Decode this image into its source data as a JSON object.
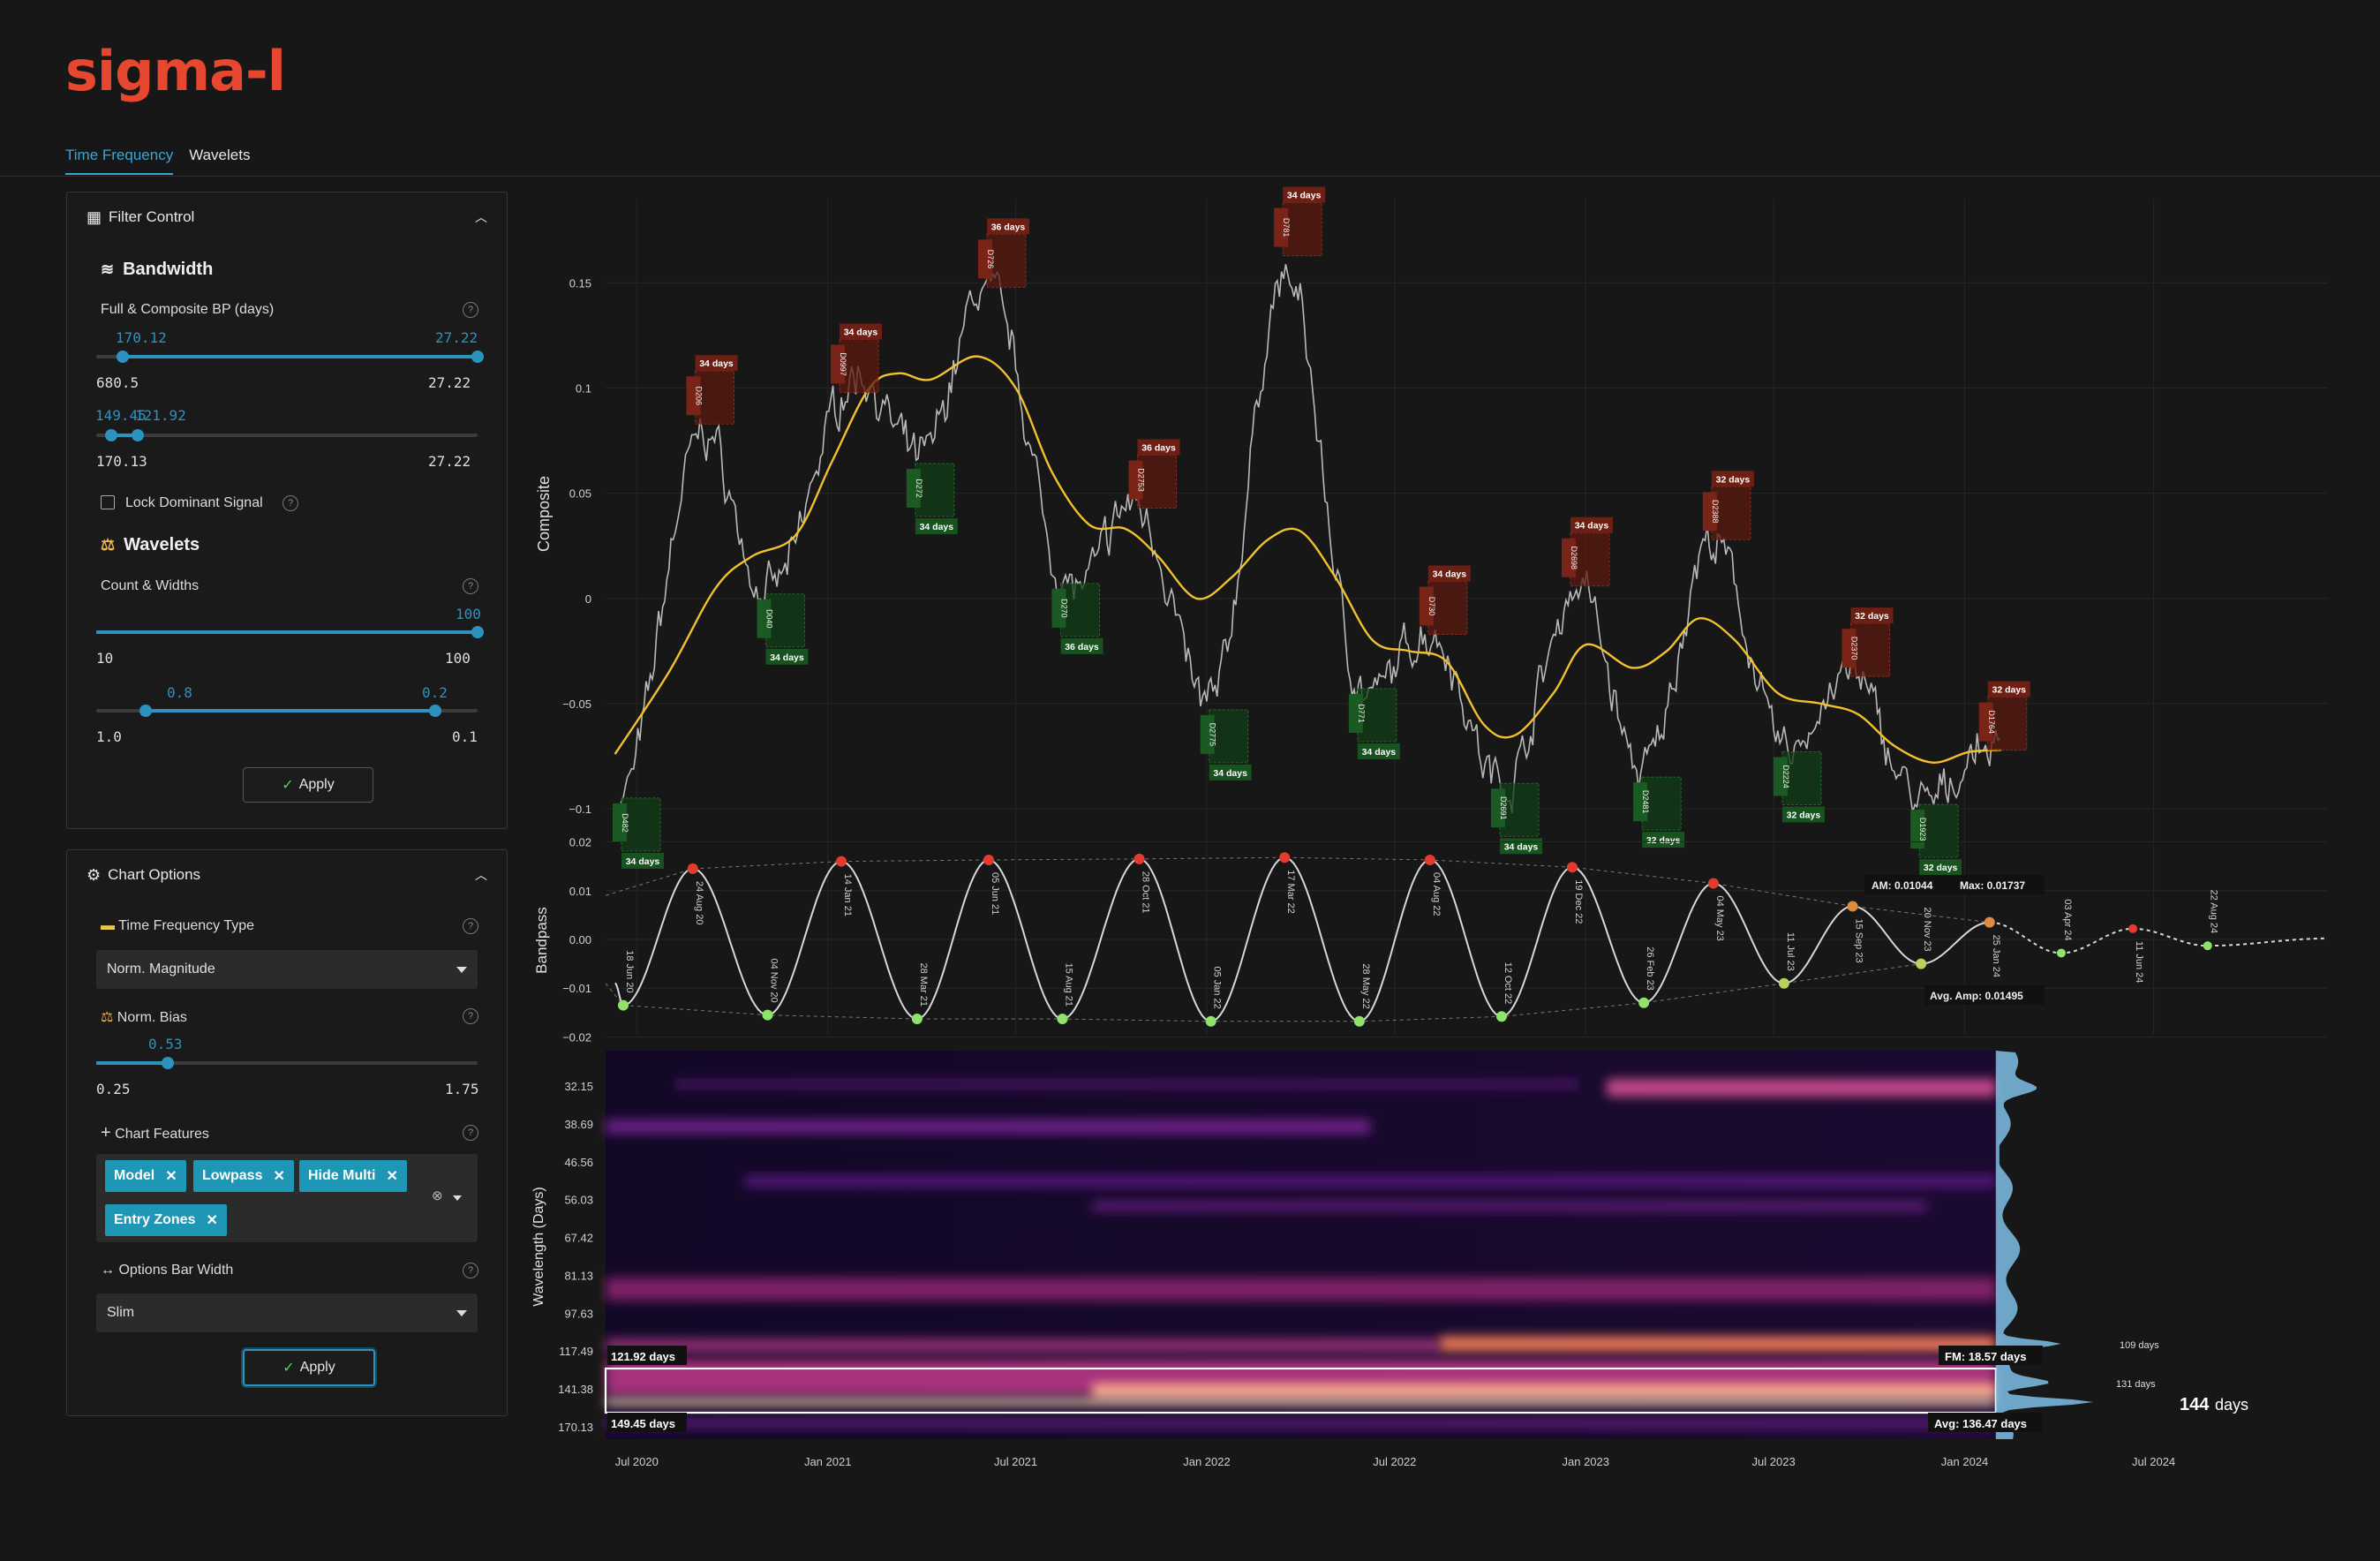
{
  "app": {
    "logo": "sigma-l"
  },
  "tabs": [
    {
      "label": "Time Frequency",
      "active": true
    },
    {
      "label": "Wavelets",
      "active": false
    }
  ],
  "filter_control": {
    "title": "Filter Control",
    "bandwidth": {
      "heading": "Bandwidth",
      "label": "Full & Composite BP (days)",
      "slider1": {
        "low_value": "170.12",
        "high_value": "27.22",
        "min_label": "680.5",
        "max_label": "27.22",
        "low_frac": 0.07,
        "high_frac": 1.0
      },
      "slider2": {
        "low_value": "149.45",
        "high_value": "121.92",
        "min_label": "170.13",
        "max_label": "27.22",
        "low_frac": 0.04,
        "high_frac": 0.108
      }
    },
    "lock_label": "Lock Dominant Signal",
    "wavelets": {
      "heading": "Wavelets",
      "label": "Count & Widths",
      "slider1": {
        "value": "100",
        "min_label": "10",
        "max_label": "100",
        "frac": 1.0
      },
      "slider2": {
        "low_value": "0.8",
        "high_value": "0.2",
        "min_label": "1.0",
        "max_label": "0.1",
        "low_frac": 0.22,
        "high_frac": 0.89
      }
    },
    "apply_label": "Apply"
  },
  "chart_options": {
    "title": "Chart Options",
    "tf_type": {
      "label": "Time Frequency Type",
      "value": "Norm. Magnitude"
    },
    "norm_bias": {
      "label": "Norm. Bias",
      "value": "0.53",
      "min_label": "0.25",
      "max_label": "1.75",
      "frac": 0.187
    },
    "features": {
      "label": "Chart Features",
      "tags": [
        "Model",
        "Lowpass",
        "Hide Multi",
        "Entry Zones"
      ]
    },
    "bar_width": {
      "label": "Options Bar Width",
      "value": "Slim"
    },
    "apply_label": "Apply"
  },
  "chart_data": [
    {
      "type": "line",
      "ylabel": "Composite",
      "ylim": [
        -0.105,
        0.19
      ],
      "yticks": [
        {
          "v": 0.15,
          "t": "0.15"
        },
        {
          "v": 0.1,
          "t": "0.1"
        },
        {
          "v": 0.05,
          "t": "0.05"
        },
        {
          "v": 0,
          "t": "0"
        },
        {
          "v": -0.05,
          "t": "−0.05"
        },
        {
          "v": -0.1,
          "t": "−0.1"
        }
      ],
      "xlim": [
        "2020-06-01",
        "2024-12-15"
      ],
      "lowpass": [
        [
          "2020-06-10",
          -0.074
        ],
        [
          "2020-08-01",
          -0.035
        ],
        [
          "2020-09-15",
          0.005
        ],
        [
          "2020-10-20",
          0.02
        ],
        [
          "2020-12-01",
          0.03
        ],
        [
          "2021-01-05",
          0.065
        ],
        [
          "2021-02-10",
          0.1
        ],
        [
          "2021-03-10",
          0.107
        ],
        [
          "2021-04-10",
          0.104
        ],
        [
          "2021-05-25",
          0.115
        ],
        [
          "2021-07-01",
          0.1
        ],
        [
          "2021-08-05",
          0.06
        ],
        [
          "2021-09-10",
          0.035
        ],
        [
          "2021-10-15",
          0.033
        ],
        [
          "2021-11-15",
          0.02
        ],
        [
          "2021-12-22",
          0.0
        ],
        [
          "2022-01-25",
          0.01
        ],
        [
          "2022-03-01",
          0.028
        ],
        [
          "2022-04-01",
          0.032
        ],
        [
          "2022-05-05",
          0.01
        ],
        [
          "2022-06-10",
          -0.02
        ],
        [
          "2022-07-15",
          -0.025
        ],
        [
          "2022-08-20",
          -0.03
        ],
        [
          "2022-09-25",
          -0.06
        ],
        [
          "2022-10-25",
          -0.065
        ],
        [
          "2022-12-01",
          -0.045
        ],
        [
          "2023-01-01",
          -0.022
        ],
        [
          "2023-02-15",
          -0.033
        ],
        [
          "2023-03-20",
          -0.025
        ],
        [
          "2023-04-20",
          -0.0095
        ],
        [
          "2023-05-25",
          -0.02
        ],
        [
          "2023-07-05",
          -0.045
        ],
        [
          "2023-08-15",
          -0.05
        ],
        [
          "2023-09-20",
          -0.055
        ],
        [
          "2023-10-25",
          -0.07
        ],
        [
          "2023-12-01",
          -0.078
        ],
        [
          "2024-01-05",
          -0.073
        ],
        [
          "2024-02-05",
          -0.072
        ]
      ],
      "markers": [
        {
          "date": "2020-06-18",
          "kind": "trough",
          "code": "D482",
          "label": "34 days",
          "v": -0.097
        },
        {
          "date": "2020-08-28",
          "kind": "peak",
          "code": "D206",
          "label": "34 days",
          "v": 0.085
        },
        {
          "date": "2020-11-04",
          "kind": "trough",
          "code": "D040",
          "label": "34 days",
          "v": -0.0
        },
        {
          "date": "2021-01-14",
          "kind": "peak",
          "code": "D0997",
          "label": "34 days",
          "v": 0.1
        },
        {
          "date": "2021-03-28",
          "kind": "trough",
          "code": "D272",
          "label": "34 days",
          "v": 0.062
        },
        {
          "date": "2021-06-05",
          "kind": "peak",
          "code": "D726",
          "label": "36 days",
          "v": 0.15
        },
        {
          "date": "2021-08-15",
          "kind": "trough",
          "code": "D270",
          "label": "36 days",
          "v": 0.005
        },
        {
          "date": "2021-10-28",
          "kind": "peak",
          "code": "D2753",
          "label": "36 days",
          "v": 0.045
        },
        {
          "date": "2022-01-05",
          "kind": "trough",
          "code": "D2775",
          "label": "34 days",
          "v": -0.055
        },
        {
          "date": "2022-03-17",
          "kind": "peak",
          "code": "D781",
          "label": "34 days",
          "v": 0.165
        },
        {
          "date": "2022-05-28",
          "kind": "trough",
          "code": "D771",
          "label": "34 days",
          "v": -0.045
        },
        {
          "date": "2022-08-04",
          "kind": "peak",
          "code": "D730",
          "label": "34 days",
          "v": -0.015
        },
        {
          "date": "2022-10-12",
          "kind": "trough",
          "code": "D2691",
          "label": "34 days",
          "v": -0.09
        },
        {
          "date": "2022-12-19",
          "kind": "peak",
          "code": "D2698",
          "label": "34 days",
          "v": 0.008
        },
        {
          "date": "2023-02-26",
          "kind": "trough",
          "code": "D2481",
          "label": "32 days",
          "v": -0.087
        },
        {
          "date": "2023-05-04",
          "kind": "peak",
          "code": "D2388",
          "label": "32 days",
          "v": 0.03
        },
        {
          "date": "2023-07-11",
          "kind": "trough",
          "code": "D2224",
          "label": "32 days",
          "v": -0.075
        },
        {
          "date": "2023-09-15",
          "kind": "peak",
          "code": "D2370",
          "label": "32 days",
          "v": -0.035
        },
        {
          "date": "2023-11-20",
          "kind": "trough",
          "code": "D1923",
          "label": "32 days",
          "v": -0.1
        },
        {
          "date": "2024-01-25",
          "kind": "peak",
          "code": "D1764",
          "label": "32 days",
          "v": -0.07
        }
      ]
    },
    {
      "type": "line",
      "ylabel": "Bandpass",
      "ylim": [
        -0.021,
        0.021
      ],
      "yticks": [
        {
          "v": 0.02,
          "t": "0.02"
        },
        {
          "v": 0.01,
          "t": "0.01"
        },
        {
          "v": 0,
          "t": "0.00"
        },
        {
          "v": -0.01,
          "t": "−0.01"
        },
        {
          "v": -0.02,
          "t": "−0.02"
        }
      ],
      "extrema": [
        {
          "date": "2020-06-18",
          "label": "18 Jun 20",
          "kind": "trough",
          "v": -0.0135
        },
        {
          "date": "2020-08-24",
          "label": "24 Aug 20",
          "kind": "peak",
          "v": 0.0145
        },
        {
          "date": "2020-11-04",
          "label": "04 Nov 20",
          "kind": "trough",
          "v": -0.0155
        },
        {
          "date": "2021-01-14",
          "label": "14 Jan 21",
          "kind": "peak",
          "v": 0.016
        },
        {
          "date": "2021-03-28",
          "label": "28 Mar 21",
          "kind": "trough",
          "v": -0.0163
        },
        {
          "date": "2021-06-05",
          "label": "05 Jun 21",
          "kind": "peak",
          "v": 0.0163
        },
        {
          "date": "2021-08-15",
          "label": "15 Aug 21",
          "kind": "trough",
          "v": -0.0163
        },
        {
          "date": "2021-10-28",
          "label": "28 Oct 21",
          "kind": "peak",
          "v": 0.0165
        },
        {
          "date": "2022-01-05",
          "label": "05 Jan 22",
          "kind": "trough",
          "v": -0.0168
        },
        {
          "date": "2022-03-17",
          "label": "17 Mar 22",
          "kind": "peak",
          "v": 0.0168
        },
        {
          "date": "2022-05-28",
          "label": "28 May 22",
          "kind": "trough",
          "v": -0.0168
        },
        {
          "date": "2022-08-04",
          "label": "04 Aug 22",
          "kind": "peak",
          "v": 0.0163
        },
        {
          "date": "2022-10-12",
          "label": "12 Oct 22",
          "kind": "trough",
          "v": -0.0158
        },
        {
          "date": "2022-12-19",
          "label": "19 Dec 22",
          "kind": "peak",
          "v": 0.0148
        },
        {
          "date": "2023-02-26",
          "label": "26 Feb 23",
          "kind": "trough",
          "v": -0.013
        },
        {
          "date": "2023-05-04",
          "label": "04 May 23",
          "kind": "peak",
          "v": 0.0115
        },
        {
          "date": "2023-07-11",
          "label": "11 Jul 23",
          "kind": "trough",
          "v": -0.009
        },
        {
          "date": "2023-09-15",
          "label": "15 Sep 23",
          "kind": "peak",
          "v": 0.0068
        },
        {
          "date": "2023-11-20",
          "label": "20 Nov 23",
          "kind": "trough",
          "v": -0.005
        },
        {
          "date": "2024-01-25",
          "label": "25 Jan 24",
          "kind": "peak",
          "v": 0.0035
        }
      ],
      "forecast": [
        {
          "date": "2024-04-03",
          "label": "03 Apr 24",
          "kind": "trough",
          "v": -0.0028
        },
        {
          "date": "2024-06-11",
          "label": "11 Jun 24",
          "kind": "peak",
          "v": 0.0022
        },
        {
          "date": "2024-08-22",
          "label": "22 Aug 24",
          "kind": "trough",
          "v": -0.0013
        }
      ],
      "annotations": {
        "am": "AM: 0.01044",
        "max": "Max: 0.01737",
        "avg_amp": "Avg. Amp: 0.01495"
      }
    },
    {
      "type": "heatmap",
      "ylabel": "Wavelength (Days)",
      "yticks": [
        "32.15",
        "38.69",
        "46.56",
        "56.03",
        "67.42",
        "81.13",
        "97.63",
        "117.49",
        "141.38",
        "170.13"
      ],
      "xticks": [
        {
          "date": "2020-07-01",
          "t": "Jul 2020"
        },
        {
          "date": "2021-01-01",
          "t": "Jan 2021"
        },
        {
          "date": "2021-07-01",
          "t": "Jul 2021"
        },
        {
          "date": "2022-01-01",
          "t": "Jan 2022"
        },
        {
          "date": "2022-07-01",
          "t": "Jul 2022"
        },
        {
          "date": "2023-01-01",
          "t": "Jan 2023"
        },
        {
          "date": "2023-07-01",
          "t": "Jul 2023"
        },
        {
          "date": "2024-01-01",
          "t": "Jan 2024"
        },
        {
          "date": "2024-07-01",
          "t": "Jul 2024"
        }
      ],
      "band": {
        "upper": "121.92 days",
        "lower": "149.45 days",
        "fm": "FM: 18.57 days",
        "avg": "Avg: 136.47 days"
      },
      "spectrum_labels": {
        "p1": "109 days",
        "p2": "131 days",
        "dominant": "144",
        "dominant_unit": "days"
      }
    }
  ]
}
